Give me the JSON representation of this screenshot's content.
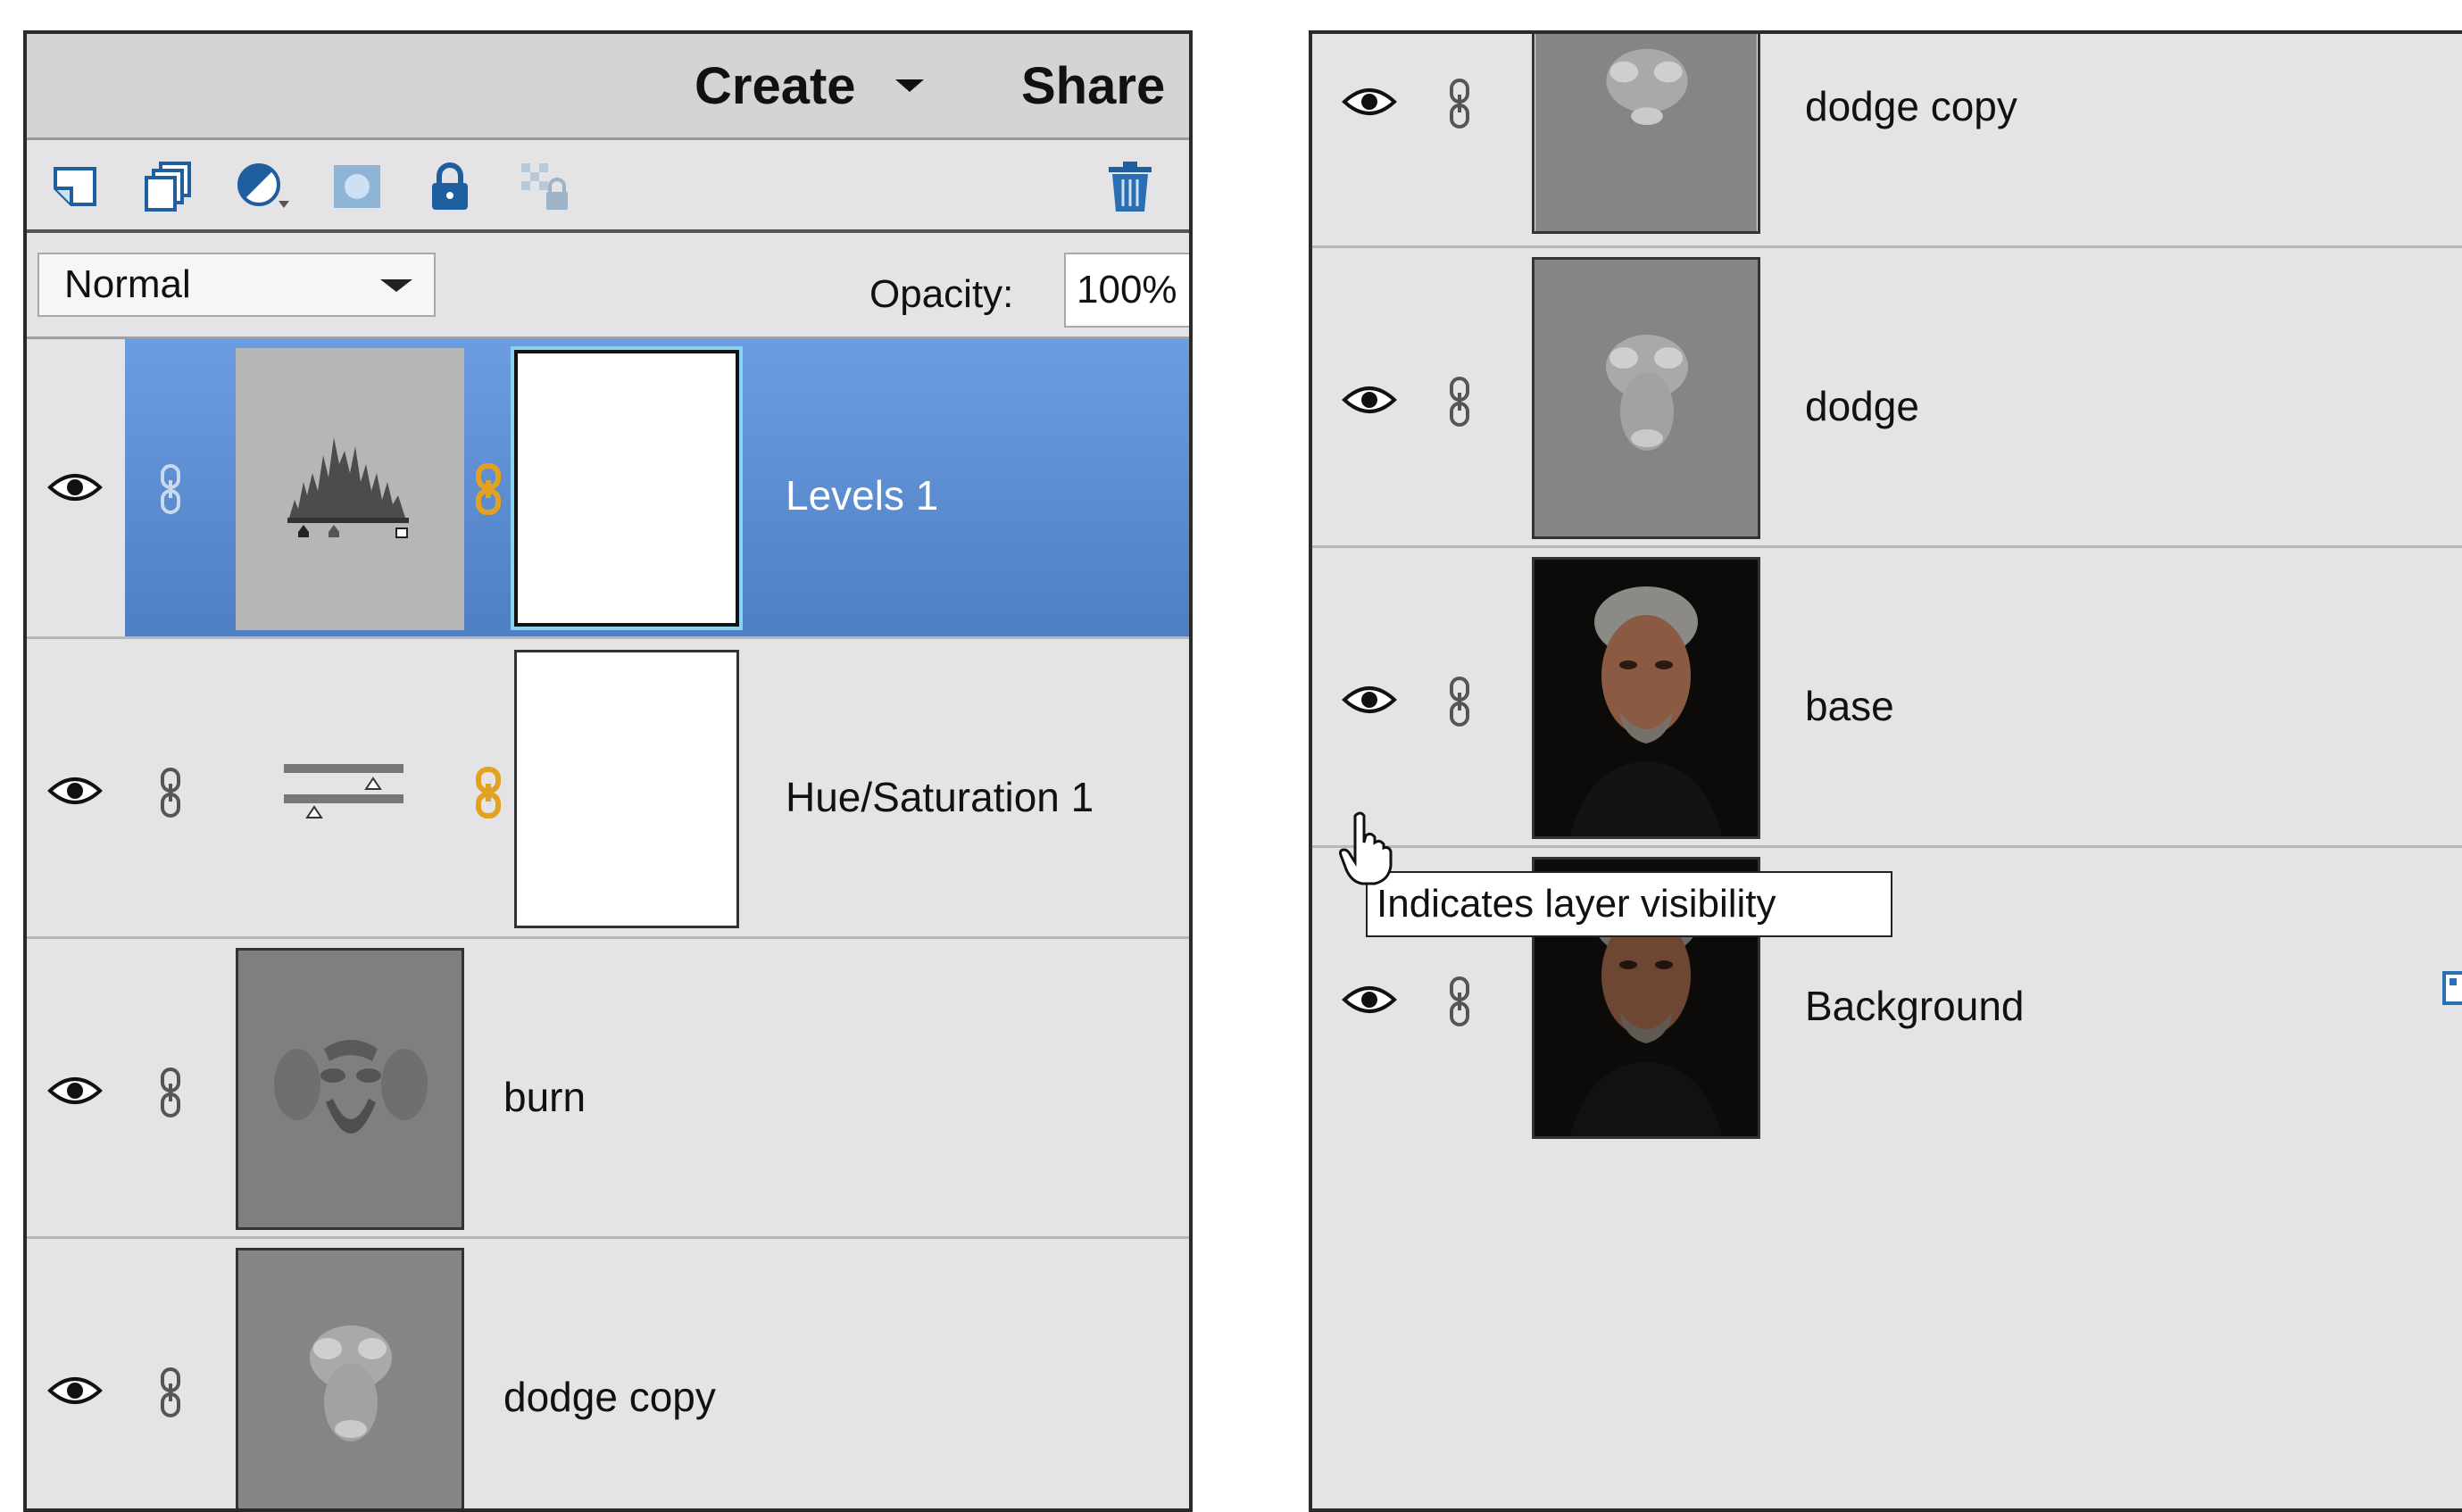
{
  "left_panel": {
    "header": {
      "create_label": "Create",
      "share_label": "Share"
    },
    "toolbar": {
      "icons": [
        "new-layer-icon",
        "new-group-icon",
        "adjustment-layer-icon",
        "add-mask-icon",
        "lock-all-icon",
        "lock-transparency-icon",
        "trash-icon"
      ]
    },
    "blend_mode": "Normal",
    "opacity_label": "Opacity:",
    "opacity_value": "100%",
    "layers": [
      {
        "name": "Levels 1",
        "type": "adjustment-levels",
        "selected": true
      },
      {
        "name": "Hue/Saturation 1",
        "type": "adjustment-hue-saturation",
        "selected": false
      },
      {
        "name": "burn",
        "type": "pixel",
        "selected": false
      },
      {
        "name": "dodge copy",
        "type": "pixel",
        "selected": false
      }
    ]
  },
  "right_panel": {
    "layers": [
      {
        "name": "dodge copy",
        "type": "pixel"
      },
      {
        "name": "dodge",
        "type": "pixel"
      },
      {
        "name": "base",
        "type": "photo"
      },
      {
        "name": "Background",
        "type": "photo"
      }
    ],
    "tooltip": "Indicates layer visibility"
  },
  "colors": {
    "selection_blue": "#5b8ad0",
    "panel_gray": "#e4e4e6",
    "header_gray": "#d4d4d6",
    "toolbar_icon_blue": "#2a6fb3",
    "link_orange": "#e3a11f"
  }
}
